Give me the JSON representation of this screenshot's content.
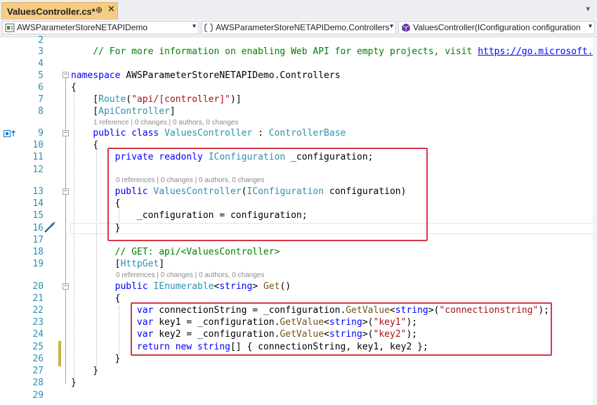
{
  "tab": {
    "title": "ValuesController.cs*",
    "pin": "⊕",
    "close": "✕",
    "dropdown": "▾"
  },
  "navbar": {
    "project": "AWSParameterStoreNETAPIDemo",
    "namespace": "AWSParameterStoreNETAPIDemo.Controllers",
    "member": "ValuesController(IConfiguration configuration",
    "dropdown": "▾"
  },
  "editor": {
    "lines": [
      {
        "num": "2",
        "text": ""
      },
      {
        "num": "3",
        "text": "    // For more information on enabling Web API for empty projects, visit https://go.microsoft.com/f"
      },
      {
        "num": "4",
        "text": ""
      },
      {
        "num": "5",
        "text": "namespace AWSParameterStoreNETAPIDemo.Controllers"
      },
      {
        "num": "6",
        "text": "{"
      },
      {
        "num": "7",
        "text": "    [Route(\"api/[controller]\")]"
      },
      {
        "num": "8",
        "text": "    [ApiController]"
      },
      {
        "num": "9",
        "text": "    public class ValuesController : ControllerBase"
      },
      {
        "num": "10",
        "text": "    {"
      },
      {
        "num": "11",
        "text": "        private readonly IConfiguration _configuration;"
      },
      {
        "num": "12",
        "text": ""
      },
      {
        "num": "13",
        "text": "        public ValuesController(IConfiguration configuration)"
      },
      {
        "num": "14",
        "text": "        {"
      },
      {
        "num": "15",
        "text": "            _configuration = configuration;"
      },
      {
        "num": "16",
        "text": "        }"
      },
      {
        "num": "17",
        "text": ""
      },
      {
        "num": "18",
        "text": "        // GET: api/<ValuesController>"
      },
      {
        "num": "19",
        "text": "        [HttpGet]"
      },
      {
        "num": "20",
        "text": "        public IEnumerable<string> Get()"
      },
      {
        "num": "21",
        "text": "        {"
      },
      {
        "num": "22",
        "text": "            var connectionString = _configuration.GetValue<string>(\"connectionstring\");"
      },
      {
        "num": "23",
        "text": "            var key1 = _configuration.GetValue<string>(\"key1\");"
      },
      {
        "num": "24",
        "text": "            var key2 = _configuration.GetValue<string>(\"key2\");"
      },
      {
        "num": "25",
        "text": "            return new string[] { connectionString, key1, key2 };"
      },
      {
        "num": "26",
        "text": "        }"
      },
      {
        "num": "27",
        "text": "    }"
      },
      {
        "num": "28",
        "text": "}"
      },
      {
        "num": "29",
        "text": ""
      }
    ],
    "codelens": {
      "class": "1 reference | 0 changes | 0 authors, 0 changes",
      "constructor": "0 references | 0 changes | 0 authors, 0 changes",
      "get": "0 references | 0 changes | 0 authors, 0 changes"
    }
  },
  "icons": {
    "tab_pin": "pin-icon",
    "project": "csharp-project-icon",
    "namespace": "namespace-icon",
    "member": "method-icon",
    "override_marker": "override-marker-icon",
    "quick_action": "screwdriver-icon"
  },
  "colors": {
    "tab_active": "#f5cc84",
    "keyword": "#0000ff",
    "type": "#2b91af",
    "string": "#a31515",
    "comment": "#008000",
    "highlight_box": "#d6364a",
    "change_marker": "#c8b53f"
  }
}
